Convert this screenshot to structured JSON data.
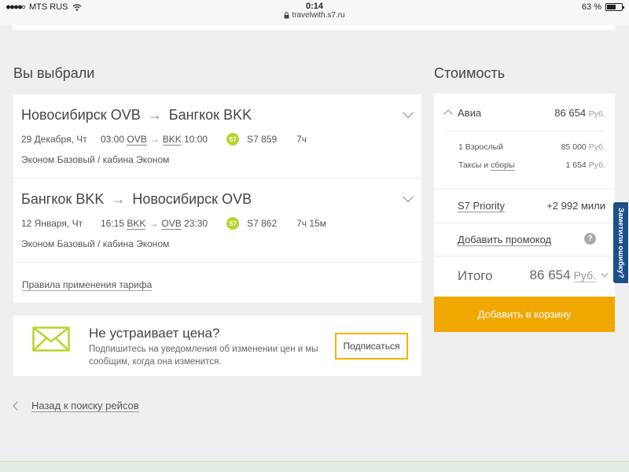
{
  "status_bar": {
    "carrier": "MTS RUS",
    "time": "0:14",
    "url": "travelwith.s7.ru",
    "battery_text": "63 %",
    "battery_level": 0.63
  },
  "selected": {
    "heading": "Вы выбрали",
    "legs": [
      {
        "from_city": "Новосибирск",
        "from_code": "OVB",
        "to_city": "Бангкок",
        "to_code": "BKK",
        "date": "29 Декабря, Чт",
        "dep_time": "03:00",
        "dep_code": "OVB",
        "arr_code": "BKK",
        "arr_time": "10:00",
        "airline_logo": "S7",
        "flight": "S7 859",
        "duration": "7ч",
        "cabin": "Эконом Базовый / кабина Эконом"
      },
      {
        "from_city": "Бангкок",
        "from_code": "BKK",
        "to_city": "Новосибирск",
        "to_code": "OVB",
        "date": "12 Января, Чт",
        "dep_time": "16:15",
        "dep_code": "BKK",
        "arr_code": "OVB",
        "arr_time": "23:30",
        "airline_logo": "S7",
        "flight": "S7 862",
        "duration": "7ч 15м",
        "cabin": "Эконом Базовый / кабина Эконом"
      }
    ],
    "tariff_link": "Правила применения тарифа"
  },
  "price_alert": {
    "title": "Не устраивает цена?",
    "text": "Подпишитесь на уведомления об изменении цен и мы сообщим, когда она изменится.",
    "button": "Подписаться"
  },
  "back_link": "Назад к поиску рейсов",
  "cost": {
    "heading": "Стоимость",
    "avia_label": "Авиа",
    "avia_price": "86 654",
    "currency": "Руб.",
    "adult_label": "1 Взрослый",
    "adult_price": "85 000",
    "taxes_label": "Таксы и",
    "fees_link": "сборы",
    "taxes_price": "1 654",
    "priority_label": "S7 Priority",
    "priority_value": "+2 992 мили",
    "promo_link": "Добавить промокод",
    "help_glyph": "?",
    "total_label": "Итого",
    "total_price": "86 654",
    "cart_button": "Добавить в корзину"
  },
  "feedback_tab": "Заметили ошибку?",
  "colors": {
    "accent": "#f0a800",
    "s7_green": "#b7d42c",
    "feedback_blue": "#1b4f8a"
  }
}
